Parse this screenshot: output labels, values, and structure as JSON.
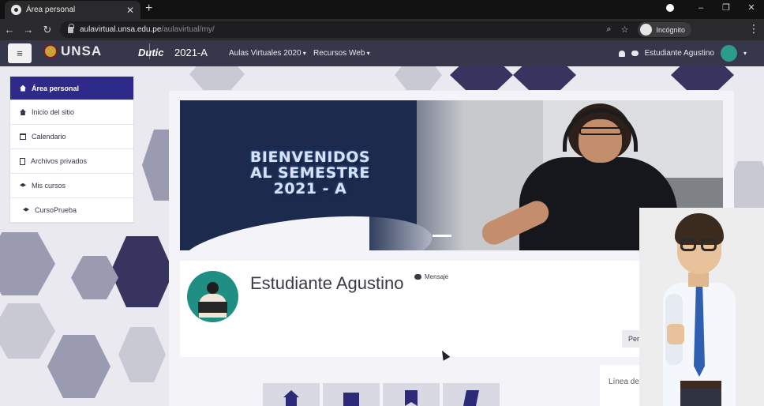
{
  "browser": {
    "tab_title": "Área personal",
    "url_host": "aulavirtual.unsa.edu.pe",
    "url_path": "/aulavirtual/my/",
    "incognito_label": "Incógnito"
  },
  "navbar": {
    "brand_unsa": "UNSA",
    "brand_dutic": "Dutic",
    "brand_year": "2021-A",
    "menu": [
      "Aulas Virtuales 2020",
      "Recursos Web"
    ],
    "user_name": "Estudiante Agustino"
  },
  "drawer": {
    "items": [
      {
        "label": "Área personal",
        "icon": "home-icon",
        "active": true
      },
      {
        "label": "Inicio del sitio",
        "icon": "home-icon"
      },
      {
        "label": "Calendario",
        "icon": "calendar-icon"
      },
      {
        "label": "Archivos privados",
        "icon": "file-icon"
      },
      {
        "label": "Mis cursos",
        "icon": "graduation-cap-icon"
      },
      {
        "label": "CursoPrueba",
        "icon": "graduation-cap-icon"
      }
    ]
  },
  "banner": {
    "line1": "BIENVENIDOS",
    "line2": "AL SEMESTRE",
    "line3": "2021 - A"
  },
  "profile": {
    "name": "Estudiante Agustino",
    "message_label": "Mensaje",
    "button_label": "Per"
  },
  "sidebar": {
    "block_label": "Línea de"
  },
  "icons": [
    "home-icon",
    "calendar-icon",
    "bookmark-icon",
    "book-icon"
  ],
  "colors": {
    "navbar": "#36374a",
    "accent": "#2d2a8a",
    "banner_dark": "#1b2a4d"
  }
}
